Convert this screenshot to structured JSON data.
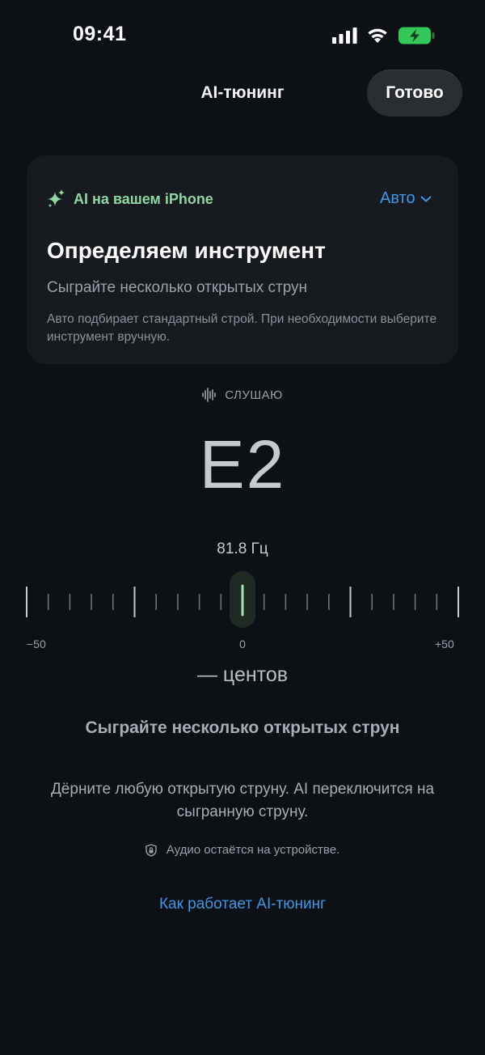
{
  "status": {
    "time": "09:41",
    "icons": [
      "cellular-signal-icon",
      "wifi-icon",
      "battery-charging-icon"
    ],
    "battery_color": "#34c759"
  },
  "nav": {
    "title": "AI-тюнинг",
    "done_label": "Готово"
  },
  "card": {
    "ai_label": "AI на вашем iPhone",
    "mode_label": "Авто",
    "title": "Определяем инструмент",
    "subtitle": "Сыграйте несколько открытых струн",
    "note": "Авто подбирает стандартный строй. При необходимости выберите инструмент вручную."
  },
  "tuner": {
    "status": "СЛУШАЮ",
    "note": "E2",
    "frequency": "81.8 Гц",
    "scale_min": "−50",
    "scale_zero": "0",
    "scale_max": "+50",
    "cents": "— центов"
  },
  "hint": {
    "title": "Сыграйте несколько открытых струн",
    "body": "Дёрните любую открытую струну. AI переключится на сыгранную струну.",
    "privacy": "Аудио остаётся на устройстве."
  },
  "link": "Как работает AI-тюнинг",
  "colors": {
    "accent_blue": "#3d97e8",
    "ai_green": "#8ed7a1",
    "needle_green": "#9be7b0",
    "background": "#0d1014"
  }
}
